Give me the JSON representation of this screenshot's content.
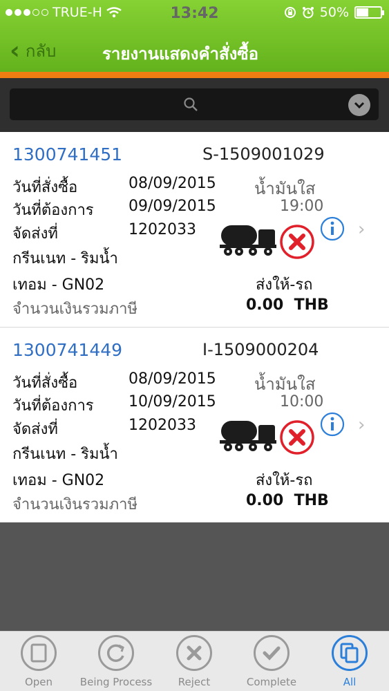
{
  "status_bar": {
    "carrier": "TRUE-H",
    "time": "13:42",
    "battery": "50%",
    "battery_level": 0.5
  },
  "nav": {
    "back_label": "กลับ",
    "title": "รายงานแสดงคำสั่งซื้อ"
  },
  "search": {
    "placeholder": ""
  },
  "labels": {
    "order_date": "วันที่สั่งซื้อ",
    "required_date": "วันที่ต้องการ",
    "ship_to": "จัดส่งที่",
    "total_amount": "จำนวนเงินรวมภาษี"
  },
  "orders": [
    {
      "order_no": "1300741451",
      "doc_no": "S-1509001029",
      "order_date": "08/09/2015",
      "product": "น้ำมันใส",
      "required_date": "09/09/2015",
      "required_time": "19:00",
      "ship_to_code": "1202033",
      "customer": "กรีนเนท - ริมน้ำ",
      "terminal": "เทอม - GN02",
      "delivery": "ส่งให้-รถ",
      "amount": "0.00",
      "currency": "THB"
    },
    {
      "order_no": "1300741449",
      "doc_no": "I-1509000204",
      "order_date": "08/09/2015",
      "product": "น้ำมันใส",
      "required_date": "10/09/2015",
      "required_time": "10:00",
      "ship_to_code": "1202033",
      "customer": "กรีนเนท - ริมน้ำ",
      "terminal": "เทอม - GN02",
      "delivery": "ส่งให้-รถ",
      "amount": "0.00",
      "currency": "THB"
    }
  ],
  "tabs": [
    {
      "label": "Open",
      "icon": "square-icon"
    },
    {
      "label": "Being Process",
      "icon": "refresh-icon"
    },
    {
      "label": "Reject",
      "icon": "x-icon"
    },
    {
      "label": "Complete",
      "icon": "check-icon"
    },
    {
      "label": "All",
      "icon": "copy-icon",
      "active": true
    }
  ],
  "colors": {
    "nav_green": "#74c02a",
    "accent_orange": "#f07d12",
    "link_blue": "#2f6ec3",
    "active_blue": "#2b7fd9",
    "reject_red": "#e0202a"
  }
}
